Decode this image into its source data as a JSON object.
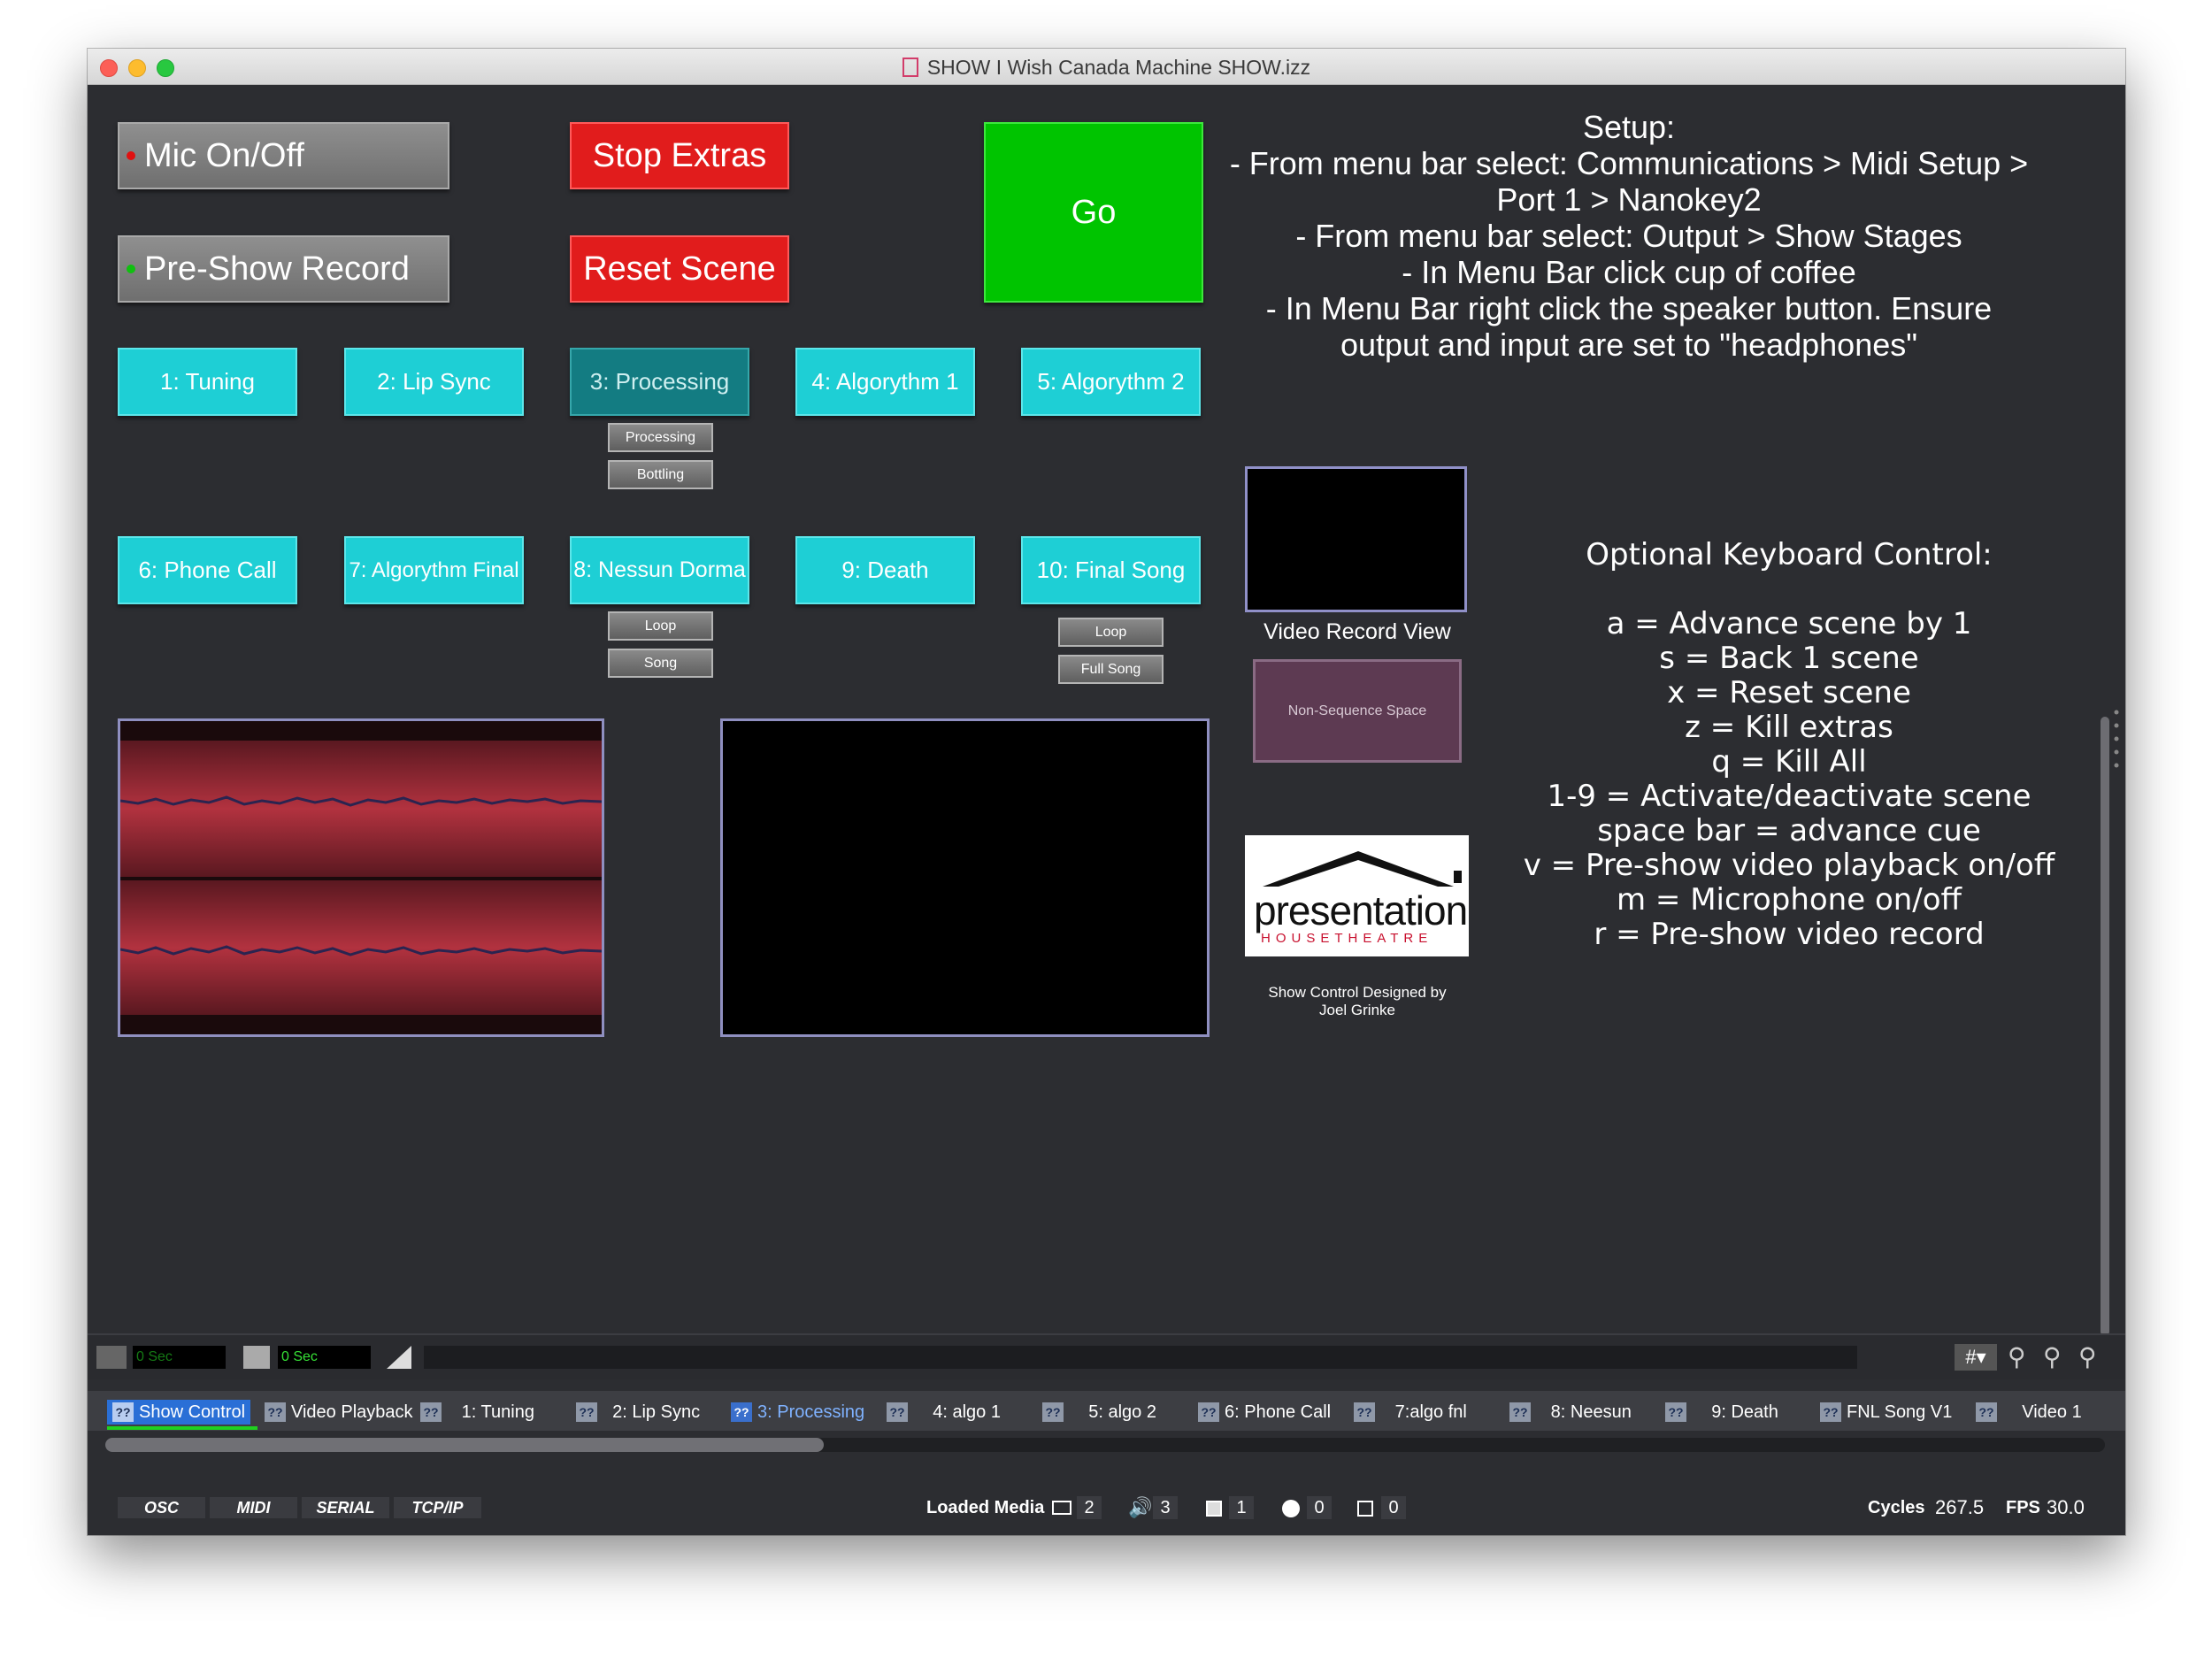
{
  "window": {
    "title": "SHOW I Wish Canada Machine SHOW.izz"
  },
  "controls": {
    "mic": "Mic On/Off",
    "preshow": "Pre-Show Record",
    "stop_extras": "Stop Extras",
    "reset_scene": "Reset Scene",
    "go": "Go"
  },
  "scenes": [
    {
      "label": "1: Tuning"
    },
    {
      "label": "2: Lip Sync"
    },
    {
      "label": "3: Processing"
    },
    {
      "label": "4: Algorythm 1"
    },
    {
      "label": "5: Algorythm 2"
    },
    {
      "label": "6: Phone Call"
    },
    {
      "label": "7: Algorythm Final"
    },
    {
      "label": "8: Nessun Dorma"
    },
    {
      "label": "9: Death"
    },
    {
      "label": "10: Final Song"
    }
  ],
  "sub_buttons": {
    "processing": "Processing",
    "bottling": "Bottling",
    "loop8": "Loop",
    "song": "Song",
    "loop10": "Loop",
    "full_song": "Full Song"
  },
  "setup": {
    "title": "Setup:",
    "lines": [
      "- From menu bar select: Communications > Midi Setup >",
      "Port 1 > Nanokey2",
      "- From menu bar select: Output > Show Stages",
      "- In Menu Bar click cup of coffee",
      "- In Menu Bar right click the speaker button. Ensure",
      "output and input are set to \"headphones\""
    ]
  },
  "video_record_label": "Video Record View",
  "non_sequence": "Non-Sequence Space",
  "logo": {
    "word": "presentation",
    "sub": "HOUSETHEATRE"
  },
  "credit": {
    "line1": "Show Control Designed by",
    "line2": "Joel Grinke"
  },
  "keyboard": {
    "title": "Optional Keyboard Control:",
    "lines": [
      "a = Advance scene by 1",
      "s = Back 1 scene",
      "x = Reset scene",
      "z = Kill extras",
      "q = Kill All",
      "1-9 = Activate/deactivate scene",
      "space bar = advance cue",
      "v = Pre-show video playback on/off",
      "m = Microphone on/off",
      "r = Pre-show video record"
    ]
  },
  "transport": {
    "time1": "0 Sec",
    "time2": "0 Sec",
    "grid": "#"
  },
  "tabs": [
    {
      "label": "Show Control",
      "active": true
    },
    {
      "label": "Video Playback"
    },
    {
      "label": "1: Tuning"
    },
    {
      "label": "2: Lip Sync"
    },
    {
      "label": "3: Processing",
      "highlight": true
    },
    {
      "label": "4: algo 1"
    },
    {
      "label": "5: algo 2"
    },
    {
      "label": "6: Phone Call"
    },
    {
      "label": "7:algo fnl"
    },
    {
      "label": "8: Neesun"
    },
    {
      "label": "9: Death"
    },
    {
      "label": "FNL Song V1"
    },
    {
      "label": "Video 1"
    }
  ],
  "tab_badge": "??",
  "protocols": [
    "OSC",
    "MIDI",
    "SERIAL",
    "TCP/IP"
  ],
  "status": {
    "loaded_media": "Loaded Media",
    "video_count": "2",
    "audio_count": "3",
    "image_count": "1",
    "other_count": "0",
    "object_count": "0",
    "cycles_label": "Cycles",
    "cycles": "267.5",
    "fps_label": "FPS",
    "fps": "30.0"
  },
  "colors": {
    "background": "#2c2d31",
    "cyan": "#1ecfd5",
    "red": "#e11c1c",
    "green": "#00c400",
    "active_tab": "#2a6fd6"
  }
}
